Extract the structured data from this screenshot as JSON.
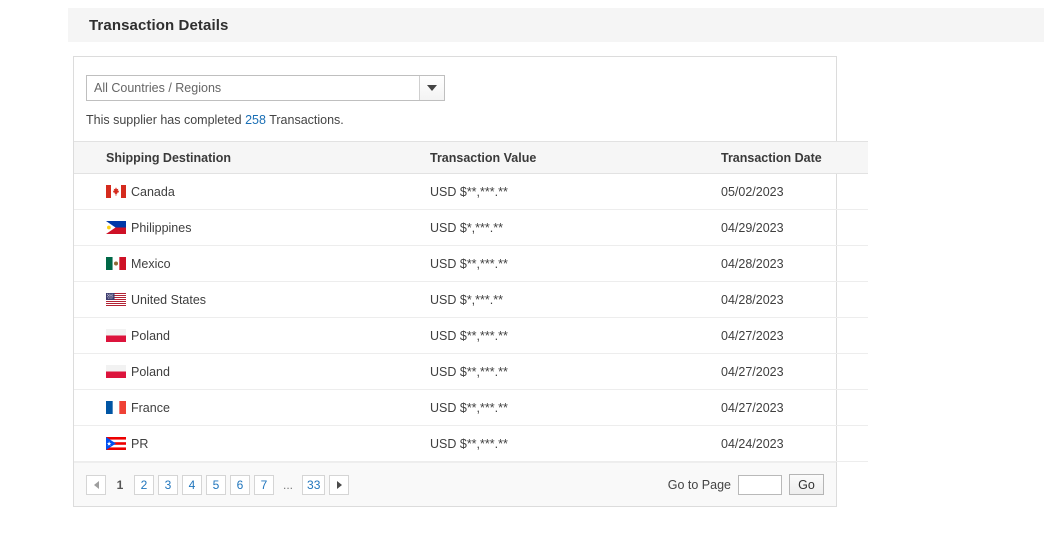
{
  "section": {
    "title": "Transaction Details"
  },
  "filter": {
    "select_name": "country-region-select",
    "selected_label": "All Countries / Regions",
    "arrow_icon": "chevron-down-icon"
  },
  "summary": {
    "prefix": "This supplier has completed ",
    "count": "258",
    "suffix": " Transactions."
  },
  "table": {
    "columns": [
      {
        "key": "destination",
        "label": "Shipping Destination"
      },
      {
        "key": "value",
        "label": "Transaction Value"
      },
      {
        "key": "date",
        "label": "Transaction Date"
      }
    ],
    "rows": [
      {
        "flag": "flag-ca",
        "destination": "Canada",
        "value": "USD $**,***.**",
        "date": "05/02/2023"
      },
      {
        "flag": "flag-ph",
        "destination": "Philippines",
        "value": "USD $*,***.**",
        "date": "04/29/2023"
      },
      {
        "flag": "flag-mx",
        "destination": "Mexico",
        "value": "USD $**,***.**",
        "date": "04/28/2023"
      },
      {
        "flag": "flag-us",
        "destination": "United States",
        "value": "USD $*,***.**",
        "date": "04/28/2023"
      },
      {
        "flag": "flag-pl",
        "destination": "Poland",
        "value": "USD $**,***.**",
        "date": "04/27/2023"
      },
      {
        "flag": "flag-pl",
        "destination": "Poland",
        "value": "USD $**,***.**",
        "date": "04/27/2023"
      },
      {
        "flag": "flag-fr",
        "destination": "France",
        "value": "USD $**,***.**",
        "date": "04/27/2023"
      },
      {
        "flag": "flag-pr",
        "destination": "PR",
        "value": "USD $**,***.**",
        "date": "04/24/2023"
      }
    ]
  },
  "pagination": {
    "prev_icon": "triangle-left-icon",
    "next_icon": "triangle-right-icon",
    "pages": [
      {
        "label": "1",
        "current": true
      },
      {
        "label": "2",
        "current": false
      },
      {
        "label": "3",
        "current": false
      },
      {
        "label": "4",
        "current": false
      },
      {
        "label": "5",
        "current": false
      },
      {
        "label": "6",
        "current": false
      },
      {
        "label": "7",
        "current": false
      },
      {
        "label": "...",
        "ellipsis": true
      },
      {
        "label": "33",
        "current": false
      }
    ],
    "goto_label": "Go to Page",
    "goto_value": "",
    "goto_placeholder": "",
    "go_button_label": "Go"
  },
  "colors": {
    "link": "#1a6fb5",
    "pager_link": "#2176bd",
    "header_bar": "#f5f5f5",
    "table_head": "#f6f6f6",
    "footer_bg": "#f9f9f9"
  }
}
